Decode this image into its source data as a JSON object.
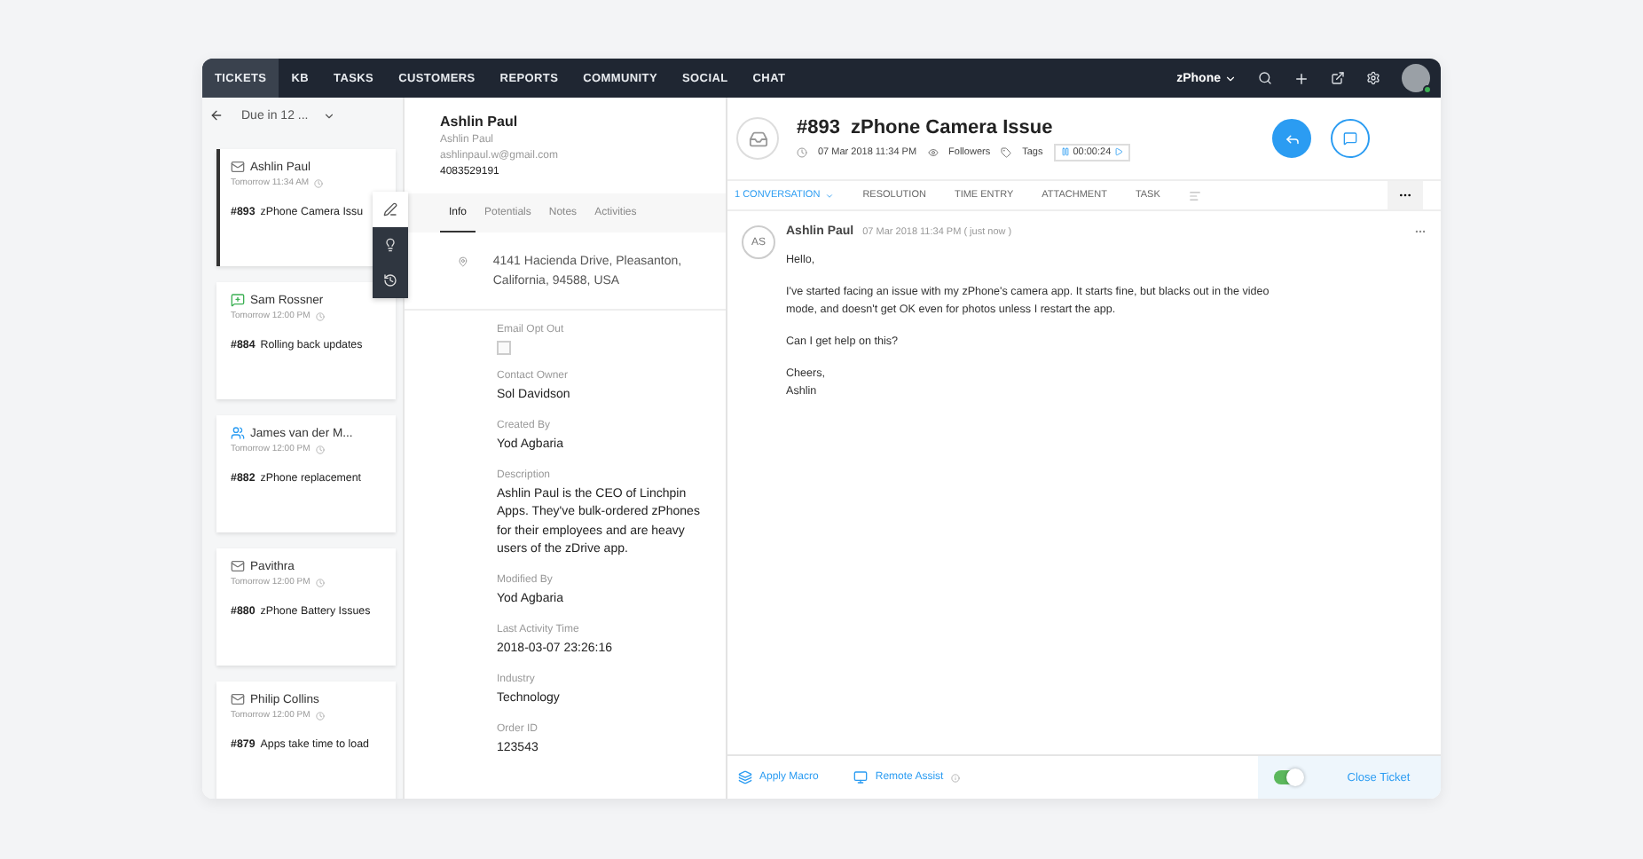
{
  "nav": {
    "tabs": [
      {
        "label": "TICKETS",
        "selected": true
      },
      {
        "label": "KB",
        "selected": false
      },
      {
        "label": "TASKS",
        "selected": false
      },
      {
        "label": "CUSTOMERS",
        "selected": false
      },
      {
        "label": "REPORTS",
        "selected": false
      },
      {
        "label": "COMMUNITY",
        "selected": false
      },
      {
        "label": "SOCIAL",
        "selected": false
      },
      {
        "label": "CHAT",
        "selected": false
      }
    ],
    "product": "zPhone",
    "online": true
  },
  "ticket_list": {
    "filter": "Due in 12 ...",
    "tickets": [
      {
        "kind": "email",
        "name": "Ashlin Paul",
        "time": "Tomorrow 11:34 AM",
        "number": "#893",
        "subject": "zPhone Camera Issu",
        "selected": true
      },
      {
        "kind": "chat",
        "name": "Sam Rossner",
        "time": "Tomorrow 12:00 PM",
        "number": "#884",
        "subject": "Rolling back updates",
        "selected": false
      },
      {
        "kind": "web",
        "name": "James van der M...",
        "time": "Tomorrow 12:00 PM",
        "number": "#882",
        "subject": "zPhone replacement",
        "selected": false
      },
      {
        "kind": "email",
        "name": "Pavithra",
        "time": "Tomorrow 12:00 PM",
        "number": "#880",
        "subject": "zPhone Battery Issues",
        "selected": false
      },
      {
        "kind": "email",
        "name": "Philip Collins",
        "time": "Tomorrow 12:00 PM",
        "number": "#879",
        "subject": "Apps take time to load",
        "selected": false
      }
    ]
  },
  "contact": {
    "name": "Ashlin Paul",
    "account": "Ashlin Paul",
    "email": "ashlinpaul.w@gmail.com",
    "phone": "4083529191",
    "tabs": [
      {
        "label": "Info",
        "selected": true
      },
      {
        "label": "Potentials",
        "selected": false
      },
      {
        "label": "Notes",
        "selected": false
      },
      {
        "label": "Activities",
        "selected": false
      }
    ],
    "address": "4141 Hacienda Drive, Pleasanton, California, 94588, USA",
    "email_opt_out": {
      "label": "Email Opt Out",
      "checked": false
    },
    "fields": [
      {
        "label": "Contact Owner",
        "value": "Sol Davidson"
      },
      {
        "label": "Created By",
        "value": "Yod Agbaria"
      },
      {
        "label": "Description",
        "value": "Ashlin Paul is the CEO of Linchpin Apps. They've bulk-ordered zPhones for their employees and are heavy users of the zDrive app."
      },
      {
        "label": "Modified By",
        "value": "Yod Agbaria"
      },
      {
        "label": "Last Activity Time",
        "value": "2018-03-07 23:26:16"
      },
      {
        "label": "Industry",
        "value": "Technology"
      },
      {
        "label": "Order ID",
        "value": "123543"
      }
    ]
  },
  "ticket": {
    "number": "#893",
    "title": "zPhone Camera Issue",
    "date": "07 Mar 2018 11:34 PM",
    "followers": "Followers",
    "tags": "Tags",
    "timer": "00:00:24",
    "tabs": [
      {
        "label": "1 CONVERSATION",
        "selected": true
      },
      {
        "label": "RESOLUTION",
        "selected": false
      },
      {
        "label": "TIME ENTRY",
        "selected": false
      },
      {
        "label": "ATTACHMENT",
        "selected": false
      },
      {
        "label": "TASK",
        "selected": false
      }
    ],
    "message": {
      "initials": "AS",
      "author": "Ashlin Paul",
      "time": "07 Mar 2018 11:34 PM ( just now )",
      "paragraphs": [
        "Hello,",
        "I've started facing an issue with my zPhone's camera app. It starts fine, but blacks out in the video mode, and doesn't get OK even for photos unless I restart the app.",
        "Can I get help on this?",
        "Cheers,\nAshlin"
      ]
    },
    "footer": {
      "apply_macro": "Apply Macro",
      "remote_assist": "Remote Assist",
      "toggle_on": true,
      "close": "Close Ticket"
    }
  }
}
